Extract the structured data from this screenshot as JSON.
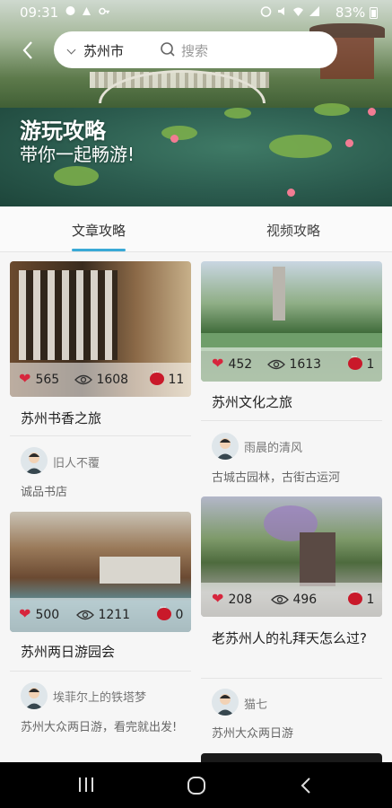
{
  "status_bar": {
    "time": "09:31",
    "battery": "83%"
  },
  "header": {
    "city": "苏州市",
    "search_placeholder": "搜索",
    "title": "游玩攻略",
    "subtitle": "带你一起畅游!"
  },
  "tabs": [
    {
      "label": "文章攻略"
    },
    {
      "label": "视频攻略"
    }
  ],
  "cards": [
    {
      "likes": "565",
      "views": "1608",
      "comments": "11",
      "title": "苏州书香之旅",
      "author": "旧人不覆",
      "desc": "诚品书店"
    },
    {
      "likes": "452",
      "views": "1613",
      "comments": "1",
      "title": "苏州文化之旅",
      "author": "雨晨的清风",
      "desc": "古城古园林，古街古运河"
    },
    {
      "likes": "500",
      "views": "1211",
      "comments": "0",
      "title": "苏州两日游园会",
      "author": "埃菲尔上的铁塔梦",
      "desc": "苏州大众两日游，看完就出发!"
    },
    {
      "likes": "208",
      "views": "496",
      "comments": "1",
      "title": "老苏州人的礼拜天怎么过?",
      "author": "猫七",
      "desc": "苏州大众两日游"
    }
  ],
  "colors": {
    "accent": "#39a9d6",
    "heart": "#d7263d",
    "comment": "#c9192a"
  }
}
